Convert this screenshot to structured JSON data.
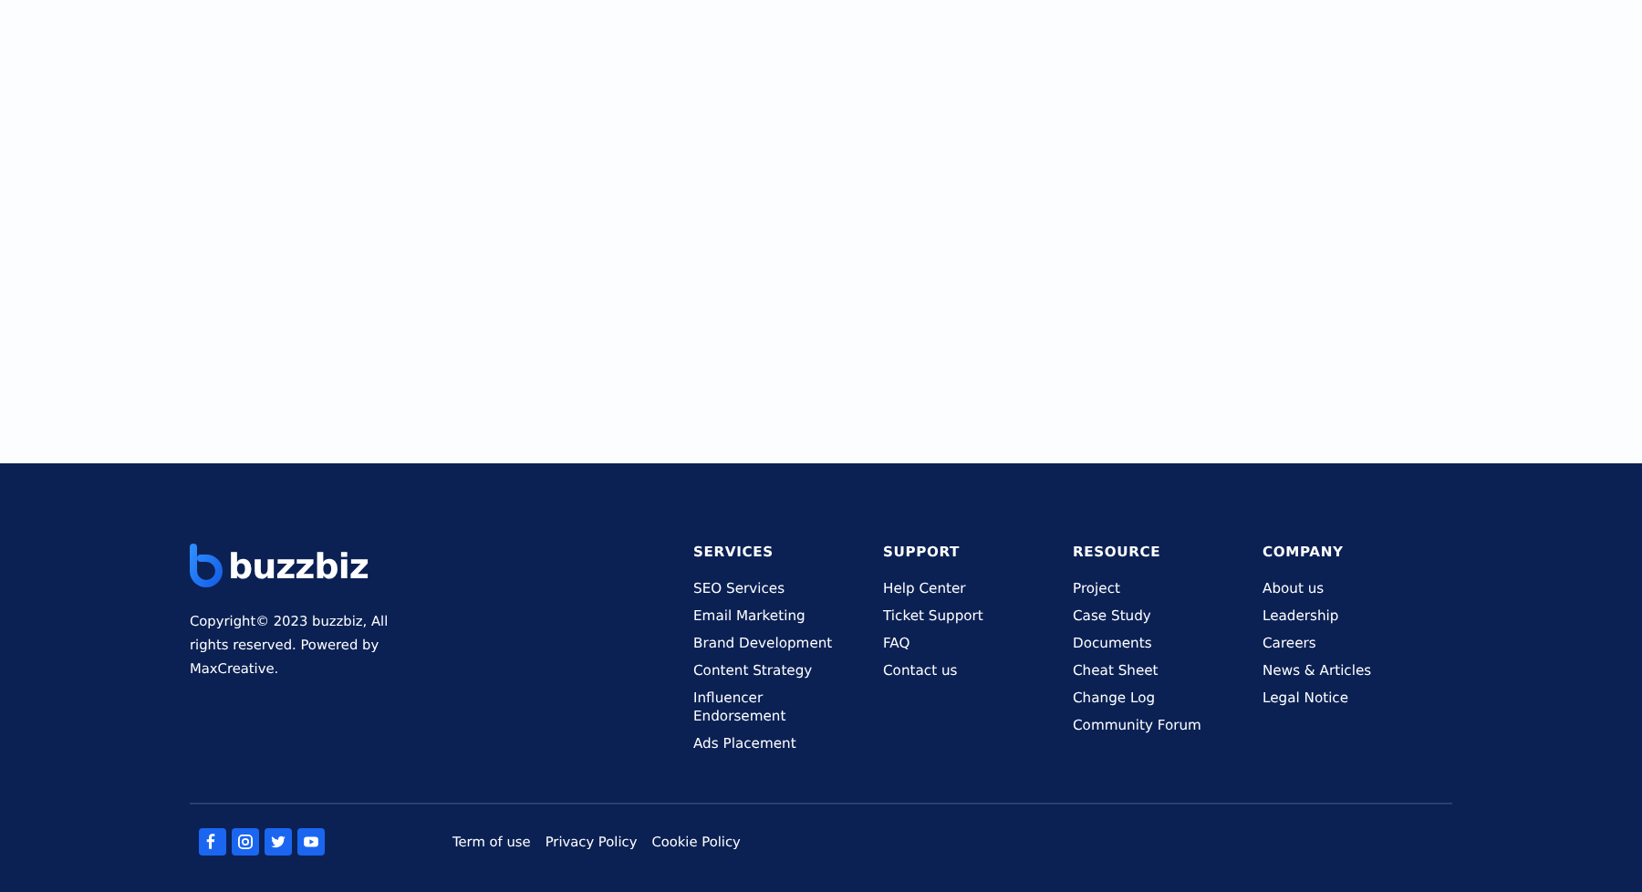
{
  "brand": {
    "name": "buzzbiz",
    "copyright": "Copyright© 2023 buzzbiz, All rights reserved. Powered by MaxCreative."
  },
  "columns": [
    {
      "title": "SERVICES",
      "links": [
        "SEO Services",
        "Email Marketing",
        "Brand Development",
        "Content Strategy",
        "Influencer Endorsement",
        "Ads Placement"
      ]
    },
    {
      "title": "SUPPORT",
      "links": [
        "Help Center",
        "Ticket Support",
        "FAQ",
        "Contact us"
      ]
    },
    {
      "title": "RESOURCE",
      "links": [
        "Project",
        "Case Study",
        "Documents",
        "Cheat Sheet",
        "Change Log",
        "Community Forum"
      ]
    },
    {
      "title": "COMPANY",
      "links": [
        "About us",
        "Leadership",
        "Careers",
        "News & Articles",
        "Legal Notice"
      ]
    }
  ],
  "social": [
    {
      "kind": "facebook"
    },
    {
      "kind": "instagram"
    },
    {
      "kind": "twitter"
    },
    {
      "kind": "youtube"
    }
  ],
  "legal_links": [
    "Term of use",
    "Privacy Policy",
    "Cookie Policy"
  ]
}
